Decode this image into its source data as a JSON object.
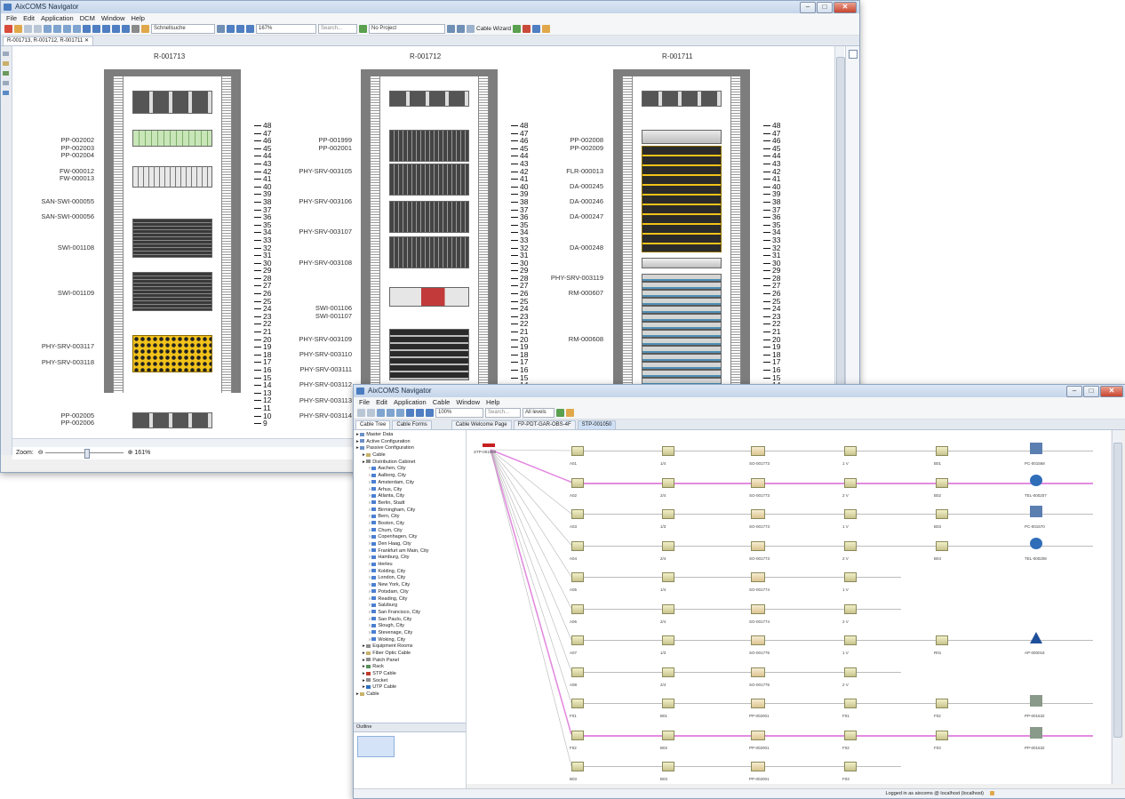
{
  "window1": {
    "title": "AixCOMS Navigator",
    "menu": [
      "File",
      "Edit",
      "Application",
      "DCM",
      "Window",
      "Help"
    ],
    "toolbar": {
      "search_combo": "Schnellsuche",
      "zoom": "167%",
      "search": "Search...",
      "project": "No Project",
      "cable_wizard": "Cable Wizard"
    },
    "editor_tab": "R-001713, R-001712, R-001711",
    "zoom_label": "Zoom:",
    "zoom_value": "161%",
    "units": [
      "48",
      "47",
      "46",
      "45",
      "44",
      "43",
      "42",
      "41",
      "40",
      "39",
      "38",
      "37",
      "36",
      "35",
      "34",
      "33",
      "32",
      "31",
      "30",
      "29",
      "28",
      "27",
      "26",
      "25",
      "24",
      "23",
      "22",
      "21",
      "20",
      "19",
      "18",
      "17",
      "16",
      "15",
      "14",
      "13",
      "12",
      "11",
      "10",
      "9"
    ],
    "racks": [
      {
        "name": "R-001713",
        "labels": [
          {
            "text": "PP-002002",
            "u": 46
          },
          {
            "text": "PP-002003",
            "u": 45
          },
          {
            "text": "PP-002004",
            "u": 44
          },
          {
            "text": "FW-000012",
            "u": 42
          },
          {
            "text": "FW-000013",
            "u": 41
          },
          {
            "text": "SAN-SWI-000055",
            "u": 38
          },
          {
            "text": "SAN-SWI-000056",
            "u": 36
          },
          {
            "text": "SWI-001108",
            "u": 32
          },
          {
            "text": "SWI-001109",
            "u": 26
          },
          {
            "text": "PHY-SRV-003117",
            "u": 19
          },
          {
            "text": "PHY-SRV-003118",
            "u": 17
          },
          {
            "text": "PP-002005",
            "u": 10
          },
          {
            "text": "PP-002006",
            "u": 9
          }
        ]
      },
      {
        "name": "R-001712",
        "labels": [
          {
            "text": "PP-001999",
            "u": 46
          },
          {
            "text": "PP-002001",
            "u": 45
          },
          {
            "text": "PHY-SRV-003105",
            "u": 42
          },
          {
            "text": "PHY-SRV-003106",
            "u": 38
          },
          {
            "text": "PHY-SRV-003107",
            "u": 34
          },
          {
            "text": "PHY-SRV-003108",
            "u": 30
          },
          {
            "text": "SWI-001106",
            "u": 24
          },
          {
            "text": "SWI-001107",
            "u": 23
          },
          {
            "text": "PHY-SRV-003109",
            "u": 20
          },
          {
            "text": "PHY-SRV-003110",
            "u": 18
          },
          {
            "text": "PHY-SRV-003111",
            "u": 16
          },
          {
            "text": "PHY-SRV-003112",
            "u": 14
          },
          {
            "text": "PHY-SRV-003113",
            "u": 12
          },
          {
            "text": "PHY-SRV-003114",
            "u": 10
          }
        ]
      },
      {
        "name": "R-001711",
        "labels": [
          {
            "text": "PP-002008",
            "u": 46
          },
          {
            "text": "PP-002009",
            "u": 45
          },
          {
            "text": "FLR-000013",
            "u": 42
          },
          {
            "text": "DA-000245",
            "u": 40
          },
          {
            "text": "DA-000246",
            "u": 38
          },
          {
            "text": "DA-000247",
            "u": 36
          },
          {
            "text": "DA-000248",
            "u": 32
          },
          {
            "text": "PHY-SRV-003119",
            "u": 28
          },
          {
            "text": "RM-000607",
            "u": 26
          },
          {
            "text": "RM-000608",
            "u": 20
          }
        ]
      }
    ]
  },
  "window2": {
    "title": "AixCOMS Navigator",
    "menu": [
      "File",
      "Edit",
      "Application",
      "Cable",
      "Window",
      "Help"
    ],
    "toolbar": {
      "zoom": "100%",
      "search": "Search...",
      "levels": "All levels"
    },
    "left_tabs": [
      "Cable Tree",
      "Cable Forms"
    ],
    "editor_tabs": [
      "Cable Welcome Page",
      "FP-PDT-GAR-OBS-4F",
      "STP-001050"
    ],
    "tree": [
      {
        "label": "Master Data",
        "depth": 0,
        "color": "#6b8fc7"
      },
      {
        "label": "Active Configuration",
        "depth": 0,
        "color": "#6b8fc7"
      },
      {
        "label": "Passive Configuration",
        "depth": 0,
        "color": "#6b8fc7"
      },
      {
        "label": "Cable",
        "depth": 1,
        "color": "#c7b36b"
      },
      {
        "label": "Distribution Cabinet",
        "depth": 1,
        "color": "#8c8c8c"
      },
      {
        "label": "Aachen, City",
        "depth": 2,
        "color": "#4b7fd1"
      },
      {
        "label": "Aalborg, City",
        "depth": 2,
        "color": "#4b7fd1"
      },
      {
        "label": "Amsterdam, City",
        "depth": 2,
        "color": "#4b7fd1"
      },
      {
        "label": "Arhus, City",
        "depth": 2,
        "color": "#4b7fd1"
      },
      {
        "label": "Atlanta, City",
        "depth": 2,
        "color": "#4b7fd1"
      },
      {
        "label": "Berlin, Stadt",
        "depth": 2,
        "color": "#4b7fd1"
      },
      {
        "label": "Birmingham, City",
        "depth": 2,
        "color": "#4b7fd1"
      },
      {
        "label": "Bern, City",
        "depth": 2,
        "color": "#4b7fd1"
      },
      {
        "label": "Boston, City",
        "depth": 2,
        "color": "#4b7fd1"
      },
      {
        "label": "Chum, City",
        "depth": 2,
        "color": "#4b7fd1"
      },
      {
        "label": "Copenhagen, City",
        "depth": 2,
        "color": "#4b7fd1"
      },
      {
        "label": "Den Haag, City",
        "depth": 2,
        "color": "#4b7fd1"
      },
      {
        "label": "Frankfurt am Main, City",
        "depth": 2,
        "color": "#4b7fd1"
      },
      {
        "label": "Hamburg, City",
        "depth": 2,
        "color": "#4b7fd1"
      },
      {
        "label": "Herleu",
        "depth": 2,
        "color": "#4b7fd1"
      },
      {
        "label": "Kolding, City",
        "depth": 2,
        "color": "#4b7fd1"
      },
      {
        "label": "London, City",
        "depth": 2,
        "color": "#4b7fd1"
      },
      {
        "label": "New York, City",
        "depth": 2,
        "color": "#4b7fd1"
      },
      {
        "label": "Potsdam, City",
        "depth": 2,
        "color": "#4b7fd1"
      },
      {
        "label": "Reading, City",
        "depth": 2,
        "color": "#4b7fd1"
      },
      {
        "label": "Salzburg",
        "depth": 2,
        "color": "#4b7fd1"
      },
      {
        "label": "San Francisco, City",
        "depth": 2,
        "color": "#4b7fd1"
      },
      {
        "label": "Sao Paulo, City",
        "depth": 2,
        "color": "#4b7fd1"
      },
      {
        "label": "Slough, City",
        "depth": 2,
        "color": "#4b7fd1"
      },
      {
        "label": "Stevenage, City",
        "depth": 2,
        "color": "#4b7fd1"
      },
      {
        "label": "Woking, City",
        "depth": 2,
        "color": "#4b7fd1"
      },
      {
        "label": "Equipment Rooms",
        "depth": 1,
        "color": "#8c8c8c"
      },
      {
        "label": "Fiber Optic Cable",
        "depth": 1,
        "color": "#c7b36b"
      },
      {
        "label": "Patch Panel",
        "depth": 1,
        "color": "#8c8c8c"
      },
      {
        "label": "Rack",
        "depth": 1,
        "color": "#5a8f5a"
      },
      {
        "label": "STP Cable",
        "depth": 1,
        "color": "#c0392b"
      },
      {
        "label": "Socket",
        "depth": 1,
        "color": "#8c8c8c"
      },
      {
        "label": "UTP Cable",
        "depth": 1,
        "color": "#2e6fbf"
      },
      {
        "label": "Cable",
        "depth": 0,
        "color": "#c7b36b"
      }
    ],
    "outline_tab": "Outline",
    "source": "STP-001050",
    "rows": [
      {
        "cells": [
          "A01",
          "1/4",
          "SO-001773",
          "1 V",
          "B01"
        ],
        "end": "PC-001568",
        "end_icon": "pc-icon",
        "pink": false
      },
      {
        "cells": [
          "A02",
          "2/4",
          "SO-001773",
          "2 V",
          "B02"
        ],
        "end": "TEL-000207",
        "end_icon": "phone-icon",
        "pink": true
      },
      {
        "cells": [
          "A03",
          "1/3",
          "SO-001773",
          "1 V",
          "B03"
        ],
        "end": "PC-001570",
        "end_icon": "pc-icon",
        "pink": false
      },
      {
        "cells": [
          "A04",
          "2/4",
          "SO-001773",
          "2 V",
          "B04"
        ],
        "end": "TEL-000208",
        "end_icon": "phone-icon",
        "pink": false
      },
      {
        "cells": [
          "A05",
          "1/4",
          "SO-001774",
          "1 V"
        ],
        "end": "",
        "end_icon": "",
        "pink": false
      },
      {
        "cells": [
          "A06",
          "2/4",
          "SO-001774",
          "2 V"
        ],
        "end": "",
        "end_icon": "",
        "pink": false
      },
      {
        "cells": [
          "A07",
          "1/3",
          "SO-001776",
          "1 V",
          "R01"
        ],
        "end": "AP-000018",
        "end_icon": "ap-icon",
        "pink": false
      },
      {
        "cells": [
          "A08",
          "2/4",
          "SO-001776",
          "2 V"
        ],
        "end": "",
        "end_icon": "",
        "pink": false
      },
      {
        "cells": [
          "F01",
          "B01",
          "PP-002001",
          "F01",
          "F02"
        ],
        "end": "PP-001532",
        "end_icon": "panel-icon",
        "pink": false
      },
      {
        "cells": [
          "F02",
          "B02",
          "PP-002001",
          "F02",
          "F03"
        ],
        "end": "PP-001532",
        "end_icon": "panel-icon",
        "pink": true
      },
      {
        "cells": [
          "B03",
          "B03",
          "PP-002001",
          "F03"
        ],
        "end": "",
        "end_icon": "",
        "pink": false
      }
    ],
    "status": "Logged in as aixcoms @ localhost (localhost)"
  }
}
